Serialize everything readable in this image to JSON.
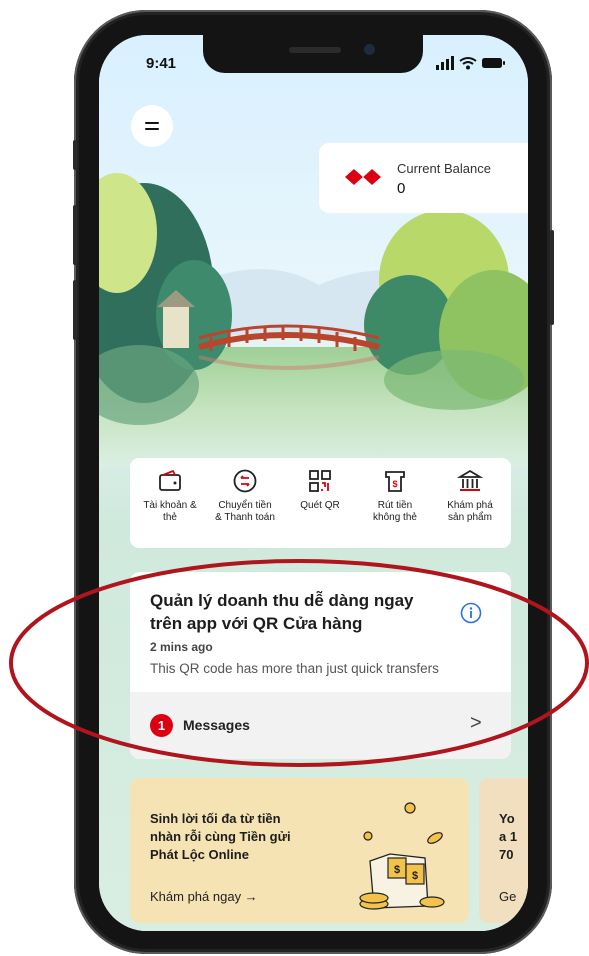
{
  "status_bar": {
    "time": "9:41"
  },
  "balance": {
    "label": "Current Balance",
    "value": "0"
  },
  "quick_actions": [
    {
      "icon": "wallet-icon",
      "label_line1": "Tài khoản &",
      "label_line2": "thẻ"
    },
    {
      "icon": "transfer-icon",
      "label_line1": "Chuyển tiền",
      "label_line2": "& Thanh toán"
    },
    {
      "icon": "qr-scan-icon",
      "label_line1": "Quét QR",
      "label_line2": ""
    },
    {
      "icon": "cardless-withdraw-icon",
      "label_line1": "Rút tiền",
      "label_line2": "không thẻ"
    },
    {
      "icon": "bank-icon",
      "label_line1": "Khám phá",
      "label_line2": "sản phẩm"
    }
  ],
  "notification": {
    "title": "Quản lý doanh thu dễ dàng ngay trên app với QR Cửa hàng",
    "time_ago": "2 mins ago",
    "description": "This QR code has more than just quick transfers"
  },
  "messages": {
    "count": "1",
    "label": "Messages",
    "chevron": ">"
  },
  "promo_cards": [
    {
      "text": "Sinh lời tối đa từ tiền nhàn rỗi cùng Tiền gửi Phát Lộc Online",
      "cta": "Khám phá ngay →"
    },
    {
      "text_line1": "Yo",
      "text_line2": "a 1",
      "text_line3": "70",
      "cta": "Ge"
    }
  ],
  "colors": {
    "brand_red": "#db0011",
    "annotation_ellipse": "#b0141c",
    "promo_bg": "#f6e3b3"
  }
}
